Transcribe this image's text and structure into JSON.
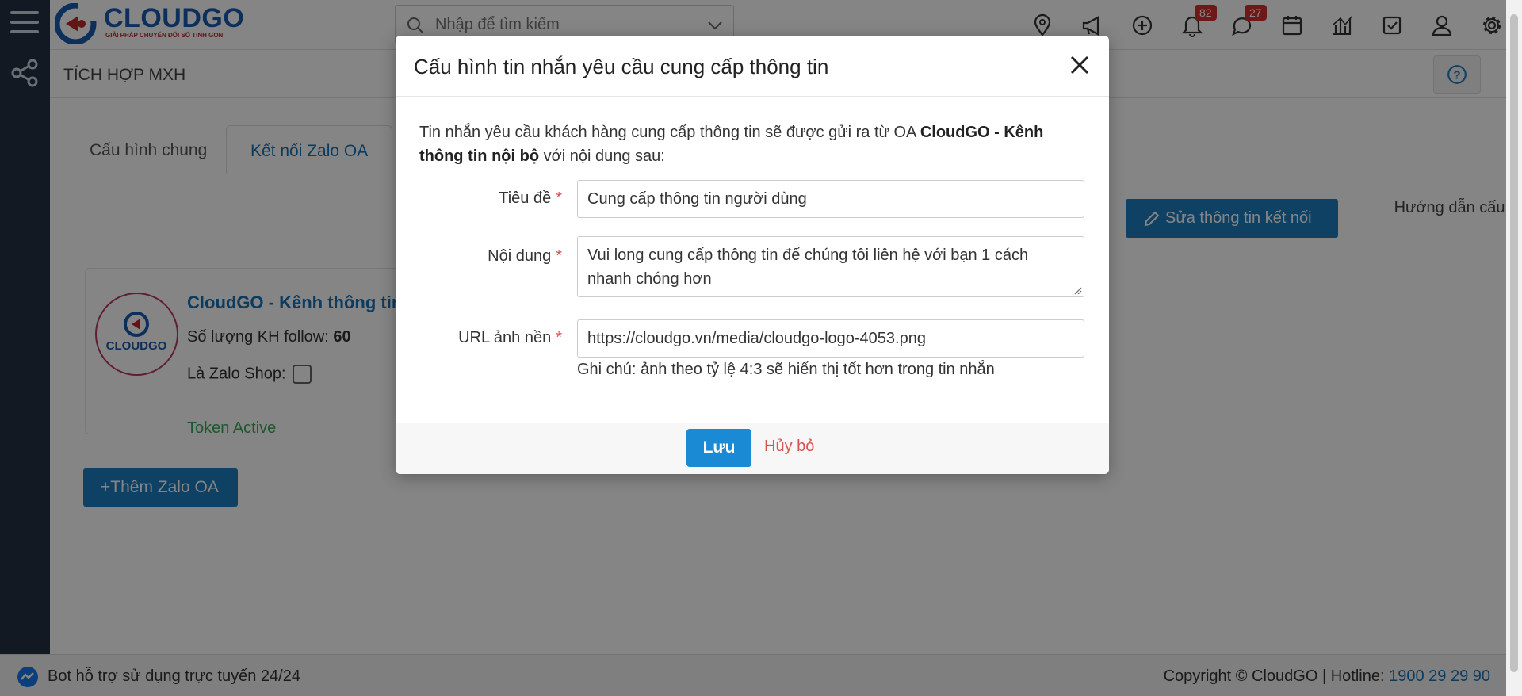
{
  "header": {
    "logo_name": "CLOUDGO",
    "logo_slogan": "GIẢI PHÁP CHUYỂN ĐỔI SỐ TINH GỌN",
    "search_placeholder": "Nhập để tìm kiếm",
    "notifications_count": "82",
    "messages_count": "27",
    "icons": [
      "map-pin-icon",
      "megaphone-icon",
      "plus-circle-icon",
      "bell-icon",
      "chat-icon",
      "calendar-icon",
      "chart-icon",
      "checkbox-icon",
      "user-icon",
      "gear-icon"
    ]
  },
  "page": {
    "title": "TÍCH HỢP MXH",
    "tabs": [
      {
        "label": "Cấu hình chung"
      },
      {
        "label": "Kết nối Zalo OA"
      }
    ],
    "edit_button": "Sửa thông tin kết nối",
    "guide_link": "Hướng dẫn cấu hình",
    "add_button": "+Thêm Zalo OA"
  },
  "oa_card": {
    "name": "CloudGO - Kênh thông tin",
    "follow_label": "Số lượng KH follow:",
    "follow_count": "60",
    "shop_label": "Là Zalo Shop:",
    "token_status": "Token Active"
  },
  "footer": {
    "bot_text": "Bot hỗ trợ sử dụng trực tuyến 24/24",
    "copyright": "Copyright © CloudGO | Hotline:",
    "hotline": "1900 29 29 90"
  },
  "modal": {
    "title": "Cấu hình tin nhắn yêu cầu cung cấp thông tin",
    "intro_prefix": "Tin nhắn yêu cầu khách hàng cung cấp thông tin sẽ được gửi ra từ OA",
    "intro_oa": "CloudGO - Kênh thông tin nội bộ",
    "intro_suffix": "với nội dung sau:",
    "fields": {
      "title_label": "Tiêu đề",
      "title_value": "Cung cấp thông tin người dùng",
      "content_label": "Nội dung",
      "content_value": "Vui long cung cấp thông tin để chúng tôi liên hệ với bạn 1 cách nhanh chóng hơn",
      "url_label": "URL ảnh nền",
      "url_value": "https://cloudgo.vn/media/cloudgo-logo-4053.png",
      "required_mark": "*"
    },
    "note": "Ghi chú: ảnh theo tỷ lệ 4:3 sẽ hiển thị tốt hơn trong tin nhắn",
    "save_button": "Lưu",
    "cancel_button": "Hủy bỏ"
  },
  "colors": {
    "accent": "#1d7dc2",
    "sidebar": "#233142",
    "danger": "#d9534f",
    "success": "#37a85a"
  }
}
